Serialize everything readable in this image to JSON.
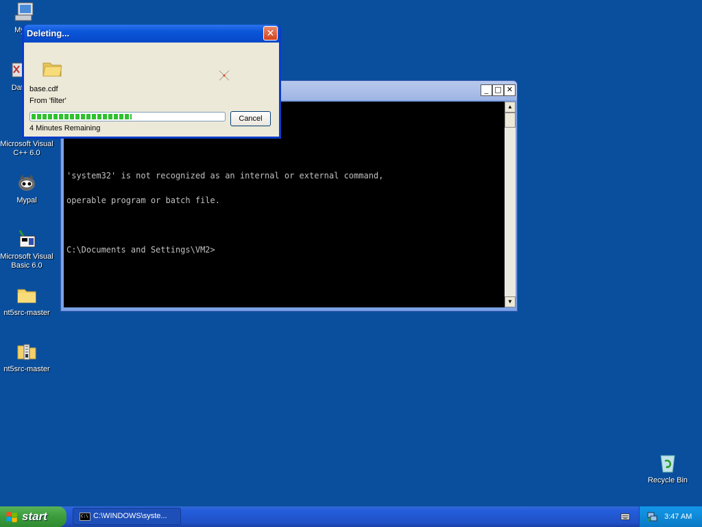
{
  "desktop": {
    "icons": [
      {
        "label": "My C",
        "icon": "my-computer-icon"
      },
      {
        "label": "DataV",
        "icon": "datav-icon"
      },
      {
        "label": "Microsoft Visual C++ 6.0",
        "icon": "visual-cpp-icon"
      },
      {
        "label": "Mypal",
        "icon": "mypal-icon"
      },
      {
        "label": "Microsoft Visual Basic 6.0",
        "icon": "visual-basic-icon"
      },
      {
        "label": "nt5src-master",
        "icon": "folder-icon"
      },
      {
        "label": "nt5src-master",
        "icon": "zip-folder-icon"
      },
      {
        "label": "Recycle Bin",
        "icon": "recycle-bin-icon"
      }
    ]
  },
  "console": {
    "lines": [
      "'system32' is not recognized as an internal or external command,",
      "operable program or batch file.",
      "",
      "C:\\Documents and Settings\\VM2>"
    ],
    "min_glyph": "_",
    "max_glyph": "□",
    "close_glyph": "✕"
  },
  "dialog": {
    "title": "Deleting...",
    "file_name": "base.cdf",
    "from_text": "From 'filter'",
    "progress": 0.52,
    "remaining": "4 Minutes Remaining",
    "cancel_label": "Cancel",
    "close_glyph": "✕"
  },
  "taskbar": {
    "start_label": "start",
    "task_label": "C:\\WINDOWS\\syste...",
    "clock": "3:47 AM"
  },
  "colors": {
    "desktop": "#0a4f9e",
    "xp_blue": "#0a55d8",
    "start_green": "#3c9c3c",
    "progress_green": "#2fc12f"
  }
}
